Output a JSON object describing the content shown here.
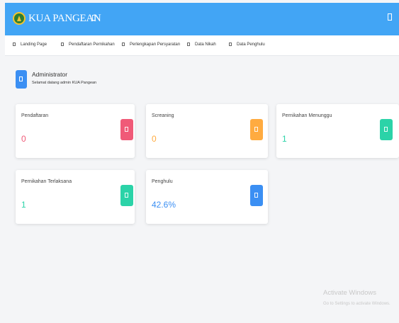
{
  "header": {
    "brand": "KUA PANGEAN",
    "color": "#42a5f5"
  },
  "nav": {
    "items": [
      {
        "label": "Landing Page"
      },
      {
        "label": "Pendaftaran Pernikahan"
      },
      {
        "label": "Perlengkapan Persyaratan"
      },
      {
        "label": "Data Nikah"
      },
      {
        "label": "Data Penghulu"
      }
    ]
  },
  "profile": {
    "title": "Administrator",
    "subtitle": "Selamat datang admin KUA Pangean"
  },
  "cards": [
    {
      "label": "Pendaftaran",
      "value": "0",
      "color": "#f05a78"
    },
    {
      "label": "Screaning",
      "value": "0",
      "color": "#ffab40"
    },
    {
      "label": "Pernikahan Menunggu",
      "value": "1",
      "color": "#2bd3a8"
    },
    {
      "label": "Pernikahan Terlaksana",
      "value": "1",
      "color": "#2bd3a8"
    },
    {
      "label": "Penghulu",
      "value": "42.6%",
      "color": "#3b8ff3"
    }
  ],
  "watermark": {
    "line1": "Activate Windows",
    "line2": "Go to Settings to activate Windows."
  }
}
